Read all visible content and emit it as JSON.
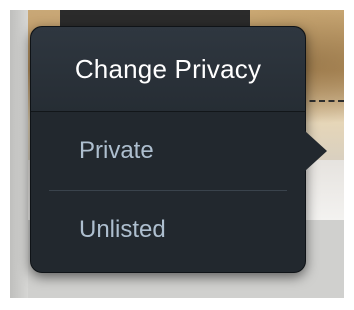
{
  "popover": {
    "title": "Change Privacy",
    "items": [
      {
        "label": "Private"
      },
      {
        "label": "Unlisted"
      }
    ]
  },
  "colors": {
    "popover_bg": "#22282e",
    "header_bg": "#2f3740",
    "title_text": "#ffffff",
    "item_text": "#aebfcf",
    "matte": "#c9c9c7"
  }
}
